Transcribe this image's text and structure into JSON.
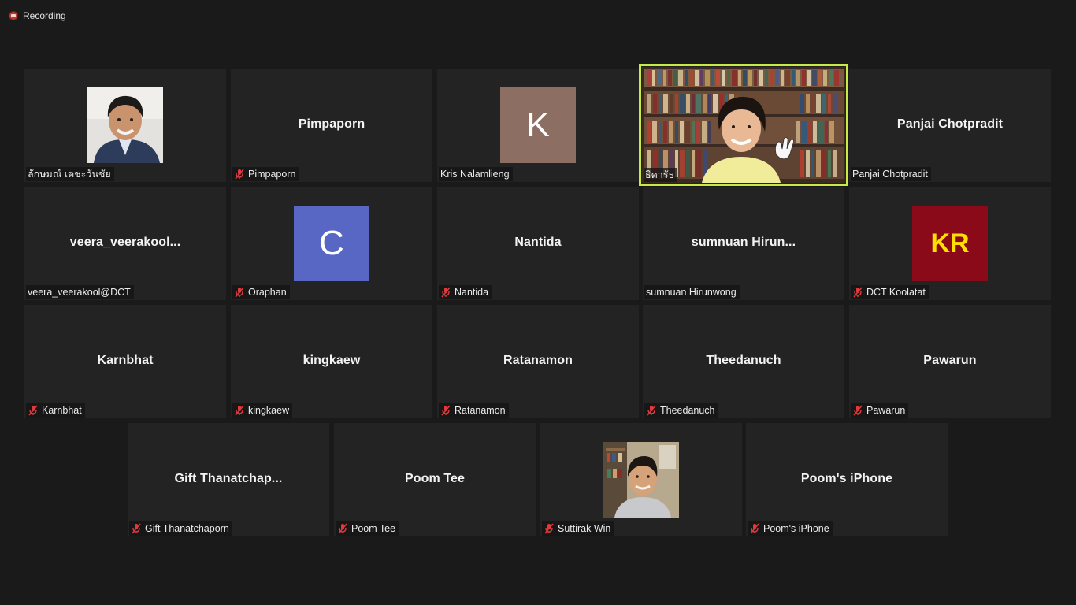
{
  "recording": {
    "label": "Recording"
  },
  "colors": {
    "active_border": "#c7ea46",
    "avatar_k": "#8d6e63",
    "avatar_c": "#5867c4",
    "avatar_kr": "#8b0a1a",
    "avatar_kr_text": "#ffe000"
  },
  "tiles": [
    {
      "name": "ลักษมณ์ เตชะวันชัย",
      "muted": false,
      "type": "photo"
    },
    {
      "name": "Pimpaporn",
      "display": "Pimpaporn",
      "muted": true,
      "type": "name"
    },
    {
      "name": "Kris Nalamlieng",
      "muted": false,
      "type": "avatar",
      "initials": "K"
    },
    {
      "name": "ธิดารัธ",
      "muted": false,
      "type": "video",
      "active": true
    },
    {
      "name": "Panjai Chotpradit",
      "display": "Panjai Chotpradit",
      "muted": false,
      "type": "name"
    },
    {
      "name": "veera_veerakool@DCT",
      "display": "veera_veerakool...",
      "muted": false,
      "type": "name"
    },
    {
      "name": "Oraphan",
      "muted": true,
      "type": "avatar",
      "initials": "C"
    },
    {
      "name": "Nantida",
      "display": "Nantida",
      "muted": true,
      "type": "name"
    },
    {
      "name": "sumnuan Hirunwong",
      "display": "sumnuan  Hirun...",
      "muted": false,
      "type": "name"
    },
    {
      "name": "DCT Koolatat",
      "muted": true,
      "type": "avatar",
      "initials": "KR"
    },
    {
      "name": "Karnbhat",
      "display": "Karnbhat",
      "muted": true,
      "type": "name"
    },
    {
      "name": "kingkaew",
      "display": "kingkaew",
      "muted": true,
      "type": "name"
    },
    {
      "name": "Ratanamon",
      "display": "Ratanamon",
      "muted": true,
      "type": "name"
    },
    {
      "name": "Theedanuch",
      "display": "Theedanuch",
      "muted": true,
      "type": "name"
    },
    {
      "name": "Pawarun",
      "display": "Pawarun",
      "muted": true,
      "type": "name"
    },
    {
      "name": "Gift Thanatchaporn",
      "display": "Gift  Thanatchap...",
      "muted": true,
      "type": "name"
    },
    {
      "name": "Poom Tee",
      "display": "Poom Tee",
      "muted": true,
      "type": "name"
    },
    {
      "name": "Suttirak Win",
      "muted": true,
      "type": "photo"
    },
    {
      "name": "Poom's iPhone",
      "display": "Poom's iPhone",
      "muted": true,
      "type": "name"
    }
  ]
}
